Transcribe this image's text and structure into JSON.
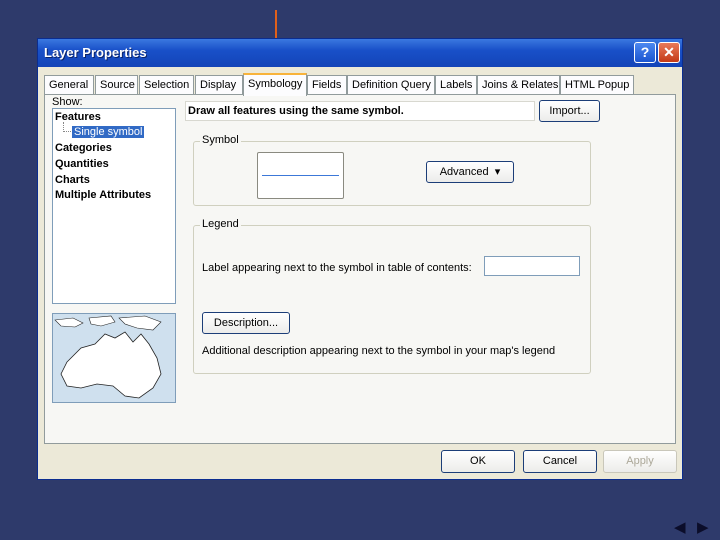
{
  "window": {
    "title": "Layer Properties",
    "help_button": "?",
    "close_button": "✕"
  },
  "tabs": [
    {
      "label": "General"
    },
    {
      "label": "Source"
    },
    {
      "label": "Selection"
    },
    {
      "label": "Display"
    },
    {
      "label": "Symbology",
      "active": true
    },
    {
      "label": "Fields"
    },
    {
      "label": "Definition Query"
    },
    {
      "label": "Labels"
    },
    {
      "label": "Joins & Relates"
    },
    {
      "label": "HTML Popup"
    }
  ],
  "show": {
    "label": "Show:",
    "items": [
      {
        "label": "Features"
      },
      {
        "label": "Single symbol",
        "selected": true
      },
      {
        "label": "Categories"
      },
      {
        "label": "Quantities"
      },
      {
        "label": "Charts"
      },
      {
        "label": "Multiple Attributes"
      }
    ]
  },
  "main": {
    "description": "Draw all features using the same symbol.",
    "import_button": "Import...",
    "symbol_group_title": "Symbol",
    "advanced_button": "Advanced",
    "legend_group_title": "Legend",
    "legend_label_text": "Label appearing next to the symbol in table of contents:",
    "legend_label_value": "",
    "description_button": "Description...",
    "description_text": "Additional description appearing next to the symbol in your map's legend"
  },
  "footer": {
    "ok": "OK",
    "cancel": "Cancel",
    "apply": "Apply"
  },
  "nav": {
    "prev": "◀",
    "next": "▶"
  },
  "colors": {
    "background": "#2e3a6b",
    "title_bar": "#1950c8",
    "arrow": "#e0601a",
    "selected": "#316ac5",
    "symbol_line": "#3c78d8"
  },
  "icons": {
    "pointer_arrow": "down-arrow-icon",
    "map_preview": "australia-map-icon"
  }
}
